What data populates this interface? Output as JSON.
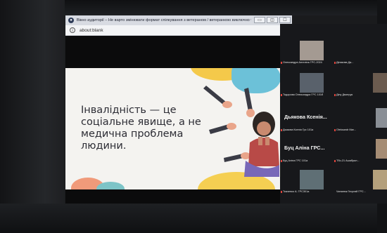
{
  "browser": {
    "title": "Вікно аудиторії – Не варто змінювати формат спілкування з ветераном / ветеранкою виключно ч...",
    "url": "about:blank",
    "window_buttons": [
      "▭",
      "◫",
      "☐"
    ]
  },
  "slide": {
    "headline": "Інвалідність — це соціальне явище, а не медична проблема людини."
  },
  "participants": [
    {
      "name": "Олександра Ангеліна ГРС-2024",
      "big": ""
    },
    {
      "name": "Дінакова Да...",
      "big": ""
    },
    {
      "name": "Тодорова Олександра ГРС 101б",
      "big": ""
    },
    {
      "name": "Діну Дмитрук",
      "big": ""
    },
    {
      "name": "Дьякова Ксенія Грс 101а",
      "big": "Дьякова Ксенія..."
    },
    {
      "name": "Oleksandr Mar...",
      "big": ""
    },
    {
      "name": "Буц Аліна ГРС 101а",
      "big": "Буц Аліна ГРС..."
    },
    {
      "name": "Тбо-21 Ашабрал...",
      "big": ""
    },
    {
      "name": "Ткаченко А. ГРС301а",
      "big": ""
    },
    {
      "name": "Чипанюк Георгий ГРС...",
      "big": ""
    }
  ]
}
